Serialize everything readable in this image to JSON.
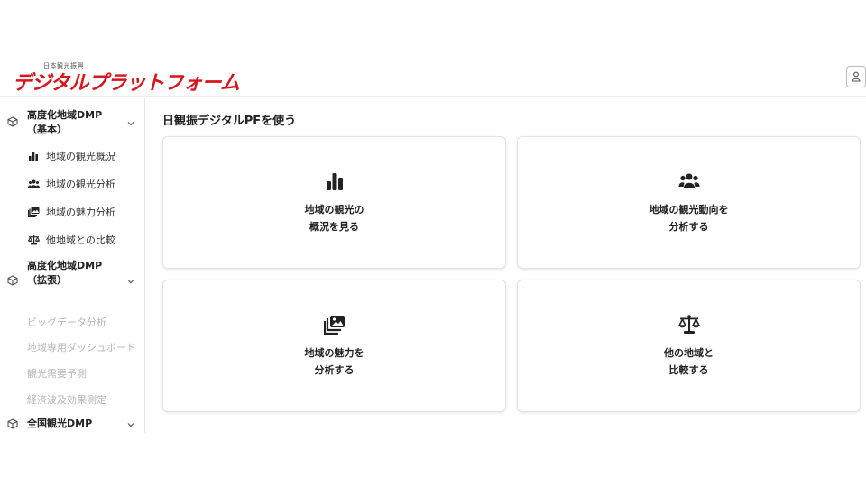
{
  "header": {
    "logo_small": "日本観光振興",
    "logo_main": "デジタルプラットフォーム"
  },
  "sidebar": {
    "groups": [
      {
        "title": "高度化地域DMP\n（基本）",
        "items": [
          {
            "label": "地域の観光概況",
            "icon": "bar-chart-icon"
          },
          {
            "label": "地域の観光分析",
            "icon": "users-icon"
          },
          {
            "label": "地域の魅力分析",
            "icon": "images-icon"
          },
          {
            "label": "他地域との比較",
            "icon": "scale-icon"
          }
        ]
      },
      {
        "title": "高度化地域DMP\n（拡張）",
        "items": [
          {
            "label": "ビッグデータ分析"
          },
          {
            "label": "地域専用ダッシュボード"
          },
          {
            "label": "観光需要予測"
          },
          {
            "label": "経済波及効果測定"
          }
        ]
      },
      {
        "title": "全国観光DMP"
      }
    ]
  },
  "main": {
    "title": "日観振デジタルPFを使う",
    "cards": [
      {
        "label": "地域の観光の\n概況を見る",
        "icon": "bar-chart-icon"
      },
      {
        "label": "地域の観光動向を\n分析する",
        "icon": "users-icon"
      },
      {
        "label": "地域の魅力を\n分析する",
        "icon": "images-icon"
      },
      {
        "label": "他の地域と\n比較する",
        "icon": "scale-icon"
      }
    ]
  },
  "colors": {
    "brand": "#d8141c",
    "text": "#222222",
    "disabled": "#b8b8b8"
  }
}
